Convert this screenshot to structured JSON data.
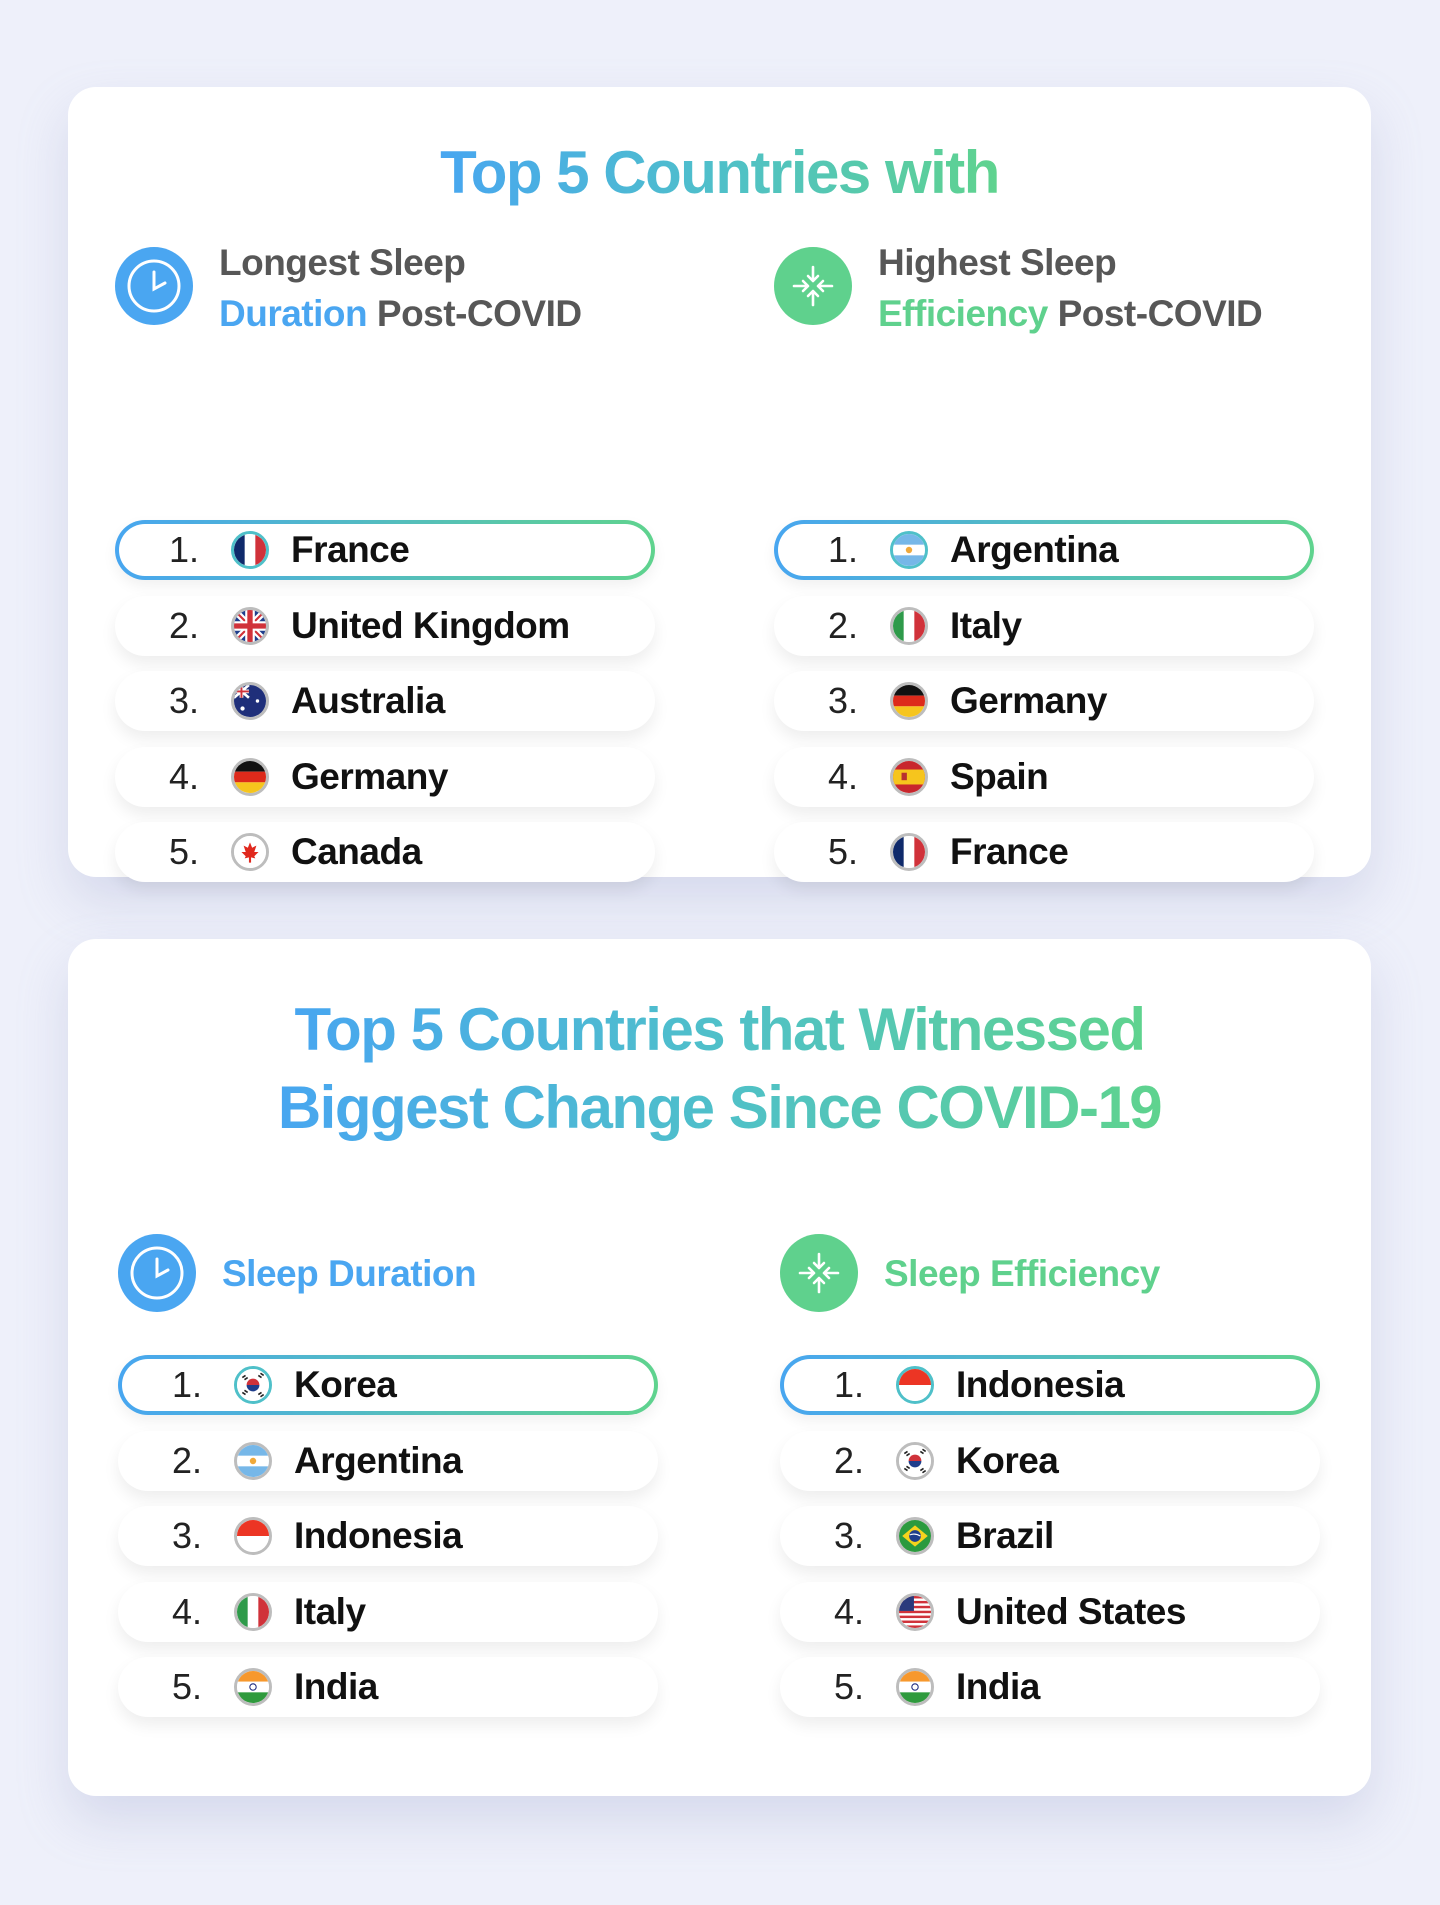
{
  "colors": {
    "blue": "#4aa6f1",
    "green": "#5fd18d",
    "text_dark": "#575757"
  },
  "section1": {
    "title": "Top 5 Countries with",
    "left": {
      "icon": "clock-icon",
      "heading_line1": "Longest Sleep",
      "heading_accent": "Duration",
      "heading_rest": " Post-COVID",
      "items": [
        {
          "rank": "1.",
          "country": "France",
          "flag": "france"
        },
        {
          "rank": "2.",
          "country": "United Kingdom",
          "flag": "uk"
        },
        {
          "rank": "3.",
          "country": "Australia",
          "flag": "australia"
        },
        {
          "rank": "4.",
          "country": "Germany",
          "flag": "germany"
        },
        {
          "rank": "5.",
          "country": "Canada",
          "flag": "canada"
        }
      ]
    },
    "right": {
      "icon": "arrows-inward-icon",
      "heading_line1": "Highest Sleep",
      "heading_accent": "Efficiency",
      "heading_rest": " Post-COVID",
      "items": [
        {
          "rank": "1.",
          "country": "Argentina",
          "flag": "argentina"
        },
        {
          "rank": "2.",
          "country": "Italy",
          "flag": "italy"
        },
        {
          "rank": "3.",
          "country": "Germany",
          "flag": "germany"
        },
        {
          "rank": "4.",
          "country": "Spain",
          "flag": "spain"
        },
        {
          "rank": "5.",
          "country": "France",
          "flag": "france"
        }
      ]
    }
  },
  "section2": {
    "title_line1": "Top 5 Countries that Witnessed",
    "title_line2": "Biggest Change Since COVID-19",
    "left": {
      "icon": "clock-icon",
      "heading": "Sleep Duration",
      "items": [
        {
          "rank": "1.",
          "country": "Korea",
          "flag": "korea"
        },
        {
          "rank": "2.",
          "country": "Argentina",
          "flag": "argentina"
        },
        {
          "rank": "3.",
          "country": "Indonesia",
          "flag": "indonesia"
        },
        {
          "rank": "4.",
          "country": "Italy",
          "flag": "italy"
        },
        {
          "rank": "5.",
          "country": "India",
          "flag": "india"
        }
      ]
    },
    "right": {
      "icon": "arrows-inward-icon",
      "heading": "Sleep Efficiency",
      "items": [
        {
          "rank": "1.",
          "country": "Indonesia",
          "flag": "indonesia"
        },
        {
          "rank": "2.",
          "country": "Korea",
          "flag": "korea"
        },
        {
          "rank": "3.",
          "country": "Brazil",
          "flag": "brazil"
        },
        {
          "rank": "4.",
          "country": "United States",
          "flag": "usa"
        },
        {
          "rank": "5.",
          "country": "India",
          "flag": "india"
        }
      ]
    }
  }
}
